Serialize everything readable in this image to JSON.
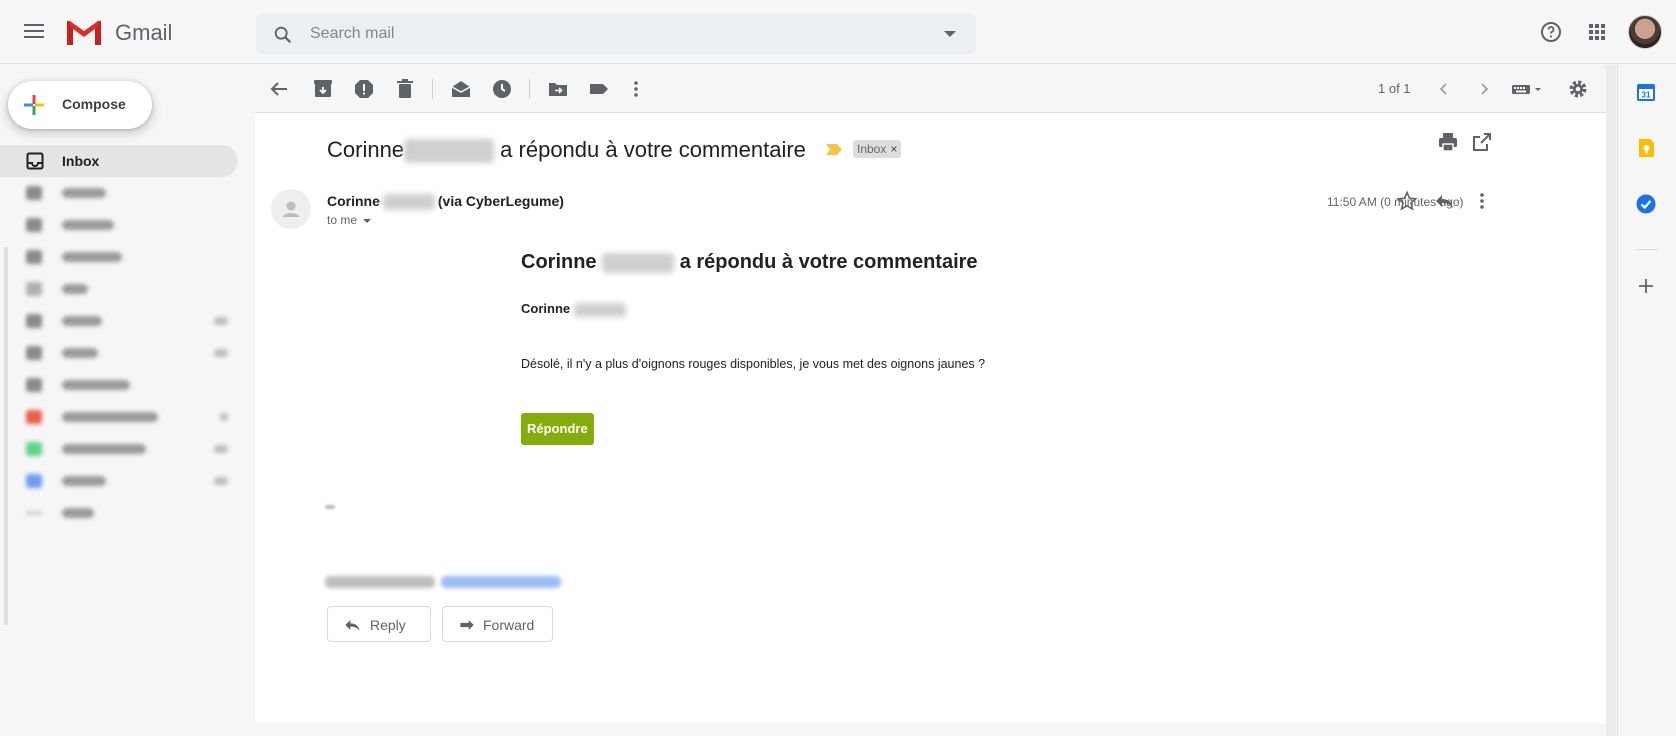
{
  "app": {
    "brand": "Gmail",
    "colors": {
      "accent_red": "#d93025",
      "respond_green": "#84ad0b",
      "important_yellow": "#f4c542"
    }
  },
  "search": {
    "placeholder": "Search mail"
  },
  "compose": {
    "label": "Compose"
  },
  "sidebar": {
    "items": [
      {
        "label": "Inbox",
        "icon": "inbox-icon",
        "active": true
      }
    ]
  },
  "toolbar": {
    "icons": [
      "back-icon",
      "archive-icon",
      "report-spam-icon",
      "delete-icon",
      "mark-unread-icon",
      "snooze-icon",
      "move-to-icon",
      "labels-icon",
      "more-icon"
    ],
    "pager": "1 of 1"
  },
  "message": {
    "subject_name": "Corinne",
    "subject_rest": "a répondu à votre commentaire",
    "label_chip": "Inbox",
    "sender_name": "Corinne",
    "sender_suffix": "(via CyberLegume)",
    "recipient": "to me",
    "time": "11:50 AM (0 minutes ago)",
    "body_heading_name": "Corinne",
    "body_heading_rest": "a répondu à votre commentaire",
    "body_author": "Corinne",
    "body_text": "Désolé, il n'y a plus d'oignons rouges disponibles, je vous met des oignons jaunes ?",
    "respond_button": "Répondre"
  },
  "actions": {
    "reply": "Reply",
    "forward": "Forward"
  }
}
